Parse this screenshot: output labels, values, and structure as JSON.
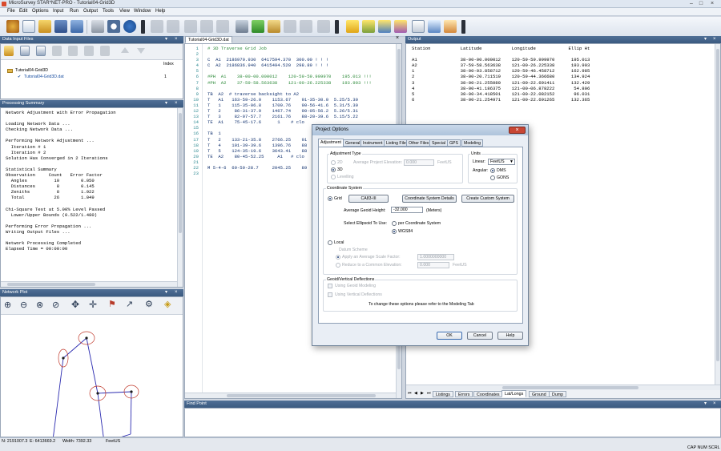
{
  "window": {
    "title": "MicroSurvey STAR*NET-PRO - Tutorial04-Grid3D"
  },
  "menu": [
    "File",
    "Edit",
    "Options",
    "Input",
    "Run",
    "Output",
    "Tools",
    "View",
    "Window",
    "Help"
  ],
  "data_input_files": {
    "title": "Data Input Files",
    "index_header": "Index",
    "project": "Tutorial04-Grid3D",
    "file": "Tutorial04-Grid3D.dat",
    "file_index": "1"
  },
  "processing_summary": {
    "title": "Processing Summary",
    "lines": [
      "Network Adjustment with Error Propagation",
      "",
      "Loading Network Data ...",
      "Checking Network Data ...",
      "",
      "Performing Network Adjustment ...",
      "  Iteration # 1",
      "  Iteration # 2",
      "Solution Has Converged in 2 Iterations",
      "",
      "Statistical Summary",
      "Observation     Count   Error Factor",
      "  Angles          10        0.050",
      "  Distances        8        0.145",
      "  Zeniths          8        1.922",
      "  Total           26        1.049",
      "",
      "Chi-Square Test at 5.00% Level Passed",
      "  Lower/Upper Bounds (0.522/1.480)",
      "",
      "Performing Error Propagation ...",
      "Writing Output Files ...",
      "",
      "Network Processing Completed",
      "Elapsed Time = 00:00:00"
    ]
  },
  "network_plot": {
    "title": "Network Plot"
  },
  "editor": {
    "tab": "Tutorial04-Grid3D.dat",
    "line_numbers": [
      "1",
      "2",
      "3",
      "4",
      "5",
      "6",
      "7",
      "8",
      "9",
      "10",
      "11",
      "12",
      "13",
      "14",
      "15",
      "16",
      "17",
      "18",
      "19",
      "20",
      "21",
      "22",
      "23"
    ],
    "lines": [
      "# 3D Traverse Grid Job",
      "",
      "C  A1  2186970.930  6417594.370  300.00 ! ! !",
      "C  A2  2186836.940  6415494.520  298.89 ! ! !",
      "",
      "#PH  A1    38-00-00.000012    120-59-59.999970    195.013 !!!",
      "#PH  A2    37-59-58.563638    121-00-26.225338    193.903 !!!",
      "",
      "TB  A2  # traverse backsight to A2",
      "T   A1   163-59-26.0    1153.67    91-35-30.0  5.25/5.30",
      "T   1    115-35-06.8    1709.76    90-56-41.6  5.31/5.30",
      "T   2     86-31-37.9    1467.74    90-05-56.2  5.26/5.31",
      "T   3     82-07-57.7    2161.76    88-20-39.6  5.15/5.22",
      "TE  A1    75-45-17.6      1    # clo",
      "",
      "TB  1",
      "T   2    133-21-35.8    2766.25    91",
      "T   4    101-39-39.6    1396.76    88",
      "T   5    124-35-19.6    3643.41    88",
      "TE  A2    80-45-52.25     A1   # clo",
      "",
      "M 5-4-6  69-59-28.7     2045.25    89",
      ""
    ]
  },
  "output": {
    "title": "Output",
    "headers": [
      "Station",
      "Latitude",
      "Longitude",
      "Ellip Ht"
    ],
    "rows": [
      [
        "A1",
        "38-00-00.000012",
        "120-59-59.999970",
        "195.013"
      ],
      [
        "A2",
        "37-59-58.563638",
        "121-00-26.225338",
        "193.903"
      ],
      [
        "1",
        "38-00-03.858712",
        "120-59-46.458712",
        "162.985"
      ],
      [
        "2",
        "38-00-20.711519",
        "120-59-44.366680",
        "134.924"
      ],
      [
        "3",
        "38-00-21.255080",
        "121-00-22.691411",
        "132.429"
      ],
      [
        "4",
        "38-00-41.186375",
        "121-00-06.878222",
        "54.806"
      ],
      [
        "5",
        "38-00-34.418501",
        "121-00-22.082152",
        "96.031"
      ],
      [
        "6",
        "38-00-21.254971",
        "121-00-22.691265",
        "132.365"
      ]
    ],
    "tabs": [
      "Listings",
      "Errors",
      "Coordinates",
      "Lat/Longs",
      "Ground",
      "Dump"
    ],
    "active_tab": "Lat/Longs"
  },
  "find_point": {
    "title": "Find Point"
  },
  "dialog": {
    "title": "Project Options",
    "tabs": [
      "Adjustment",
      "General",
      "Instrument",
      "Listing File",
      "Other Files",
      "Special",
      "GPS",
      "Modeling"
    ],
    "adjustment_type": {
      "label": "Adjustment Type",
      "opt_2d": "2D",
      "opt_3d": "3D",
      "opt_leveling": "Levelling",
      "avg_elev_label": "Average Project Elevation:",
      "avg_elev_value": "0.000",
      "avg_elev_unit": "FeetUS"
    },
    "units": {
      "label": "Units",
      "linear_label": "Linear:",
      "linear_value": "FeetUS",
      "angular_label": "Angular:",
      "opt_dms": "DMS",
      "opt_gons": "GONS"
    },
    "coordinate_system": {
      "label": "Coordinate System",
      "opt_grid": "Grid",
      "cs_button": "CA83-III",
      "details_button": "Coordinate System Details",
      "custom_button": "Create Custom System",
      "geoid_label": "Average Geoid Height:",
      "geoid_value": "-32.000",
      "geoid_unit": "(Meters)",
      "ellipsoid_label": "Select Ellipsoid To Use:",
      "opt_per_cs": "per Coordinate System",
      "opt_wgs84": "WGS84",
      "opt_local": "Local",
      "datum_label": "Datum Scheme",
      "opt_scale": "Apply an Average Scale Factor:",
      "scale_value": "1.0000000000",
      "opt_common": "Reduce to a Common Elevation:",
      "common_value": "0.000",
      "common_unit": "FeetUS"
    },
    "geoid": {
      "label": "Geoid/Vertical Deflections",
      "chk_geoid": "Using Geoid Modeling",
      "chk_vertical": "Using Vertical Deflections",
      "note": "To change these options please refer to the Modeling Tab"
    },
    "ok": "OK",
    "cancel": "Cancel",
    "help": "Help"
  },
  "status": {
    "n": "N: 2191007.3",
    "e": "E: 6413669.2",
    "width": "Width: 7392.33",
    "unit": "FeetUS",
    "indicators": "CAP  NUM  SCRL"
  }
}
